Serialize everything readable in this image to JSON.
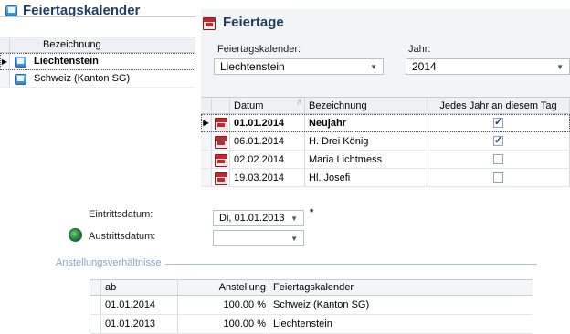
{
  "left": {
    "title": "Feiertagskalender",
    "column_header": "Bezeichnung",
    "rows": [
      {
        "label": "Liechtenstein",
        "selected": true
      },
      {
        "label": "Schweiz (Kanton SG)",
        "selected": false
      }
    ]
  },
  "right": {
    "title": "Feiertage",
    "calendar_label": "Feiertagskalender:",
    "calendar_value": "Liechtenstein",
    "year_label": "Jahr:",
    "year_value": "2014",
    "columns": {
      "date": "Datum",
      "name": "Bezeichnung",
      "yearly": "Jedes Jahr an diesem Tag"
    },
    "rows": [
      {
        "date": "01.01.2014",
        "name": "Neujahr",
        "yearly": true,
        "selected": true
      },
      {
        "date": "06.01.2014",
        "name": "H. Drei König",
        "yearly": true,
        "selected": false
      },
      {
        "date": "02.02.2014",
        "name": "Maria Lichtmess",
        "yearly": false,
        "selected": false
      },
      {
        "date": "19.03.2014",
        "name": "Hl. Josefi",
        "yearly": false,
        "selected": false
      }
    ]
  },
  "employee": {
    "entry_label": "Eintrittsdatum:",
    "entry_value": "Di, 01.01.2013",
    "required_marker": "*",
    "exit_label": "Austrittsdatum:",
    "exit_value": "",
    "section_title": "Anstellungsverhältnisse",
    "columns": {
      "from": "ab",
      "employment": "Anstellung",
      "calendar": "Feiertagskalender"
    },
    "rows": [
      {
        "from": "01.01.2014",
        "employment": "100.00 %",
        "calendar": "Schweiz (Kanton SG)"
      },
      {
        "from": "01.01.2013",
        "employment": "100.00 %",
        "calendar": "Liechtenstein"
      }
    ]
  },
  "colors": {
    "title": "#1f3f63",
    "accent_red": "#c8262a",
    "section_blue": "#8aa7c2"
  }
}
